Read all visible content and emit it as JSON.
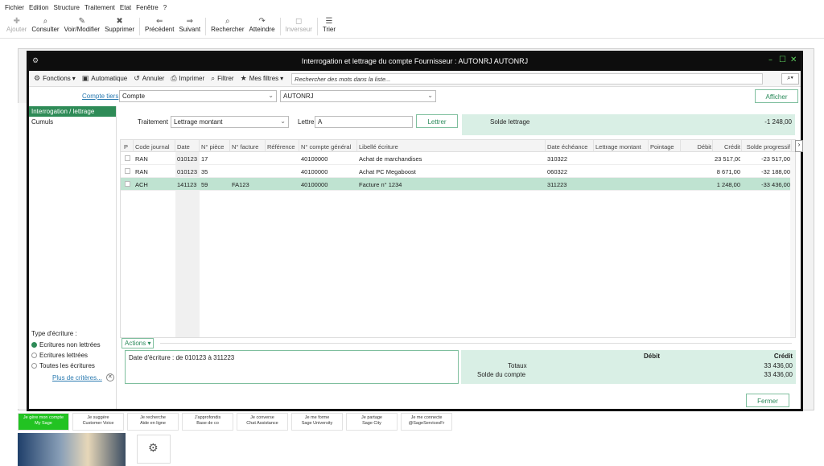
{
  "menu": [
    "Fichier",
    "Edition",
    "Structure",
    "Traitement",
    "Etat",
    "Fenêtre",
    "?"
  ],
  "toolbar": [
    {
      "label": "Ajouter",
      "icon": "plus-icon",
      "glyph": "✚",
      "disabled": true
    },
    {
      "label": "Consulter",
      "icon": "search-icon",
      "glyph": "⌕",
      "disabled": false
    },
    {
      "label": "Voir/Modifier",
      "icon": "edit-icon",
      "glyph": "✎",
      "disabled": false
    },
    {
      "label": "Supprimer",
      "icon": "delete-icon",
      "glyph": "✖",
      "disabled": false
    },
    {
      "label": "Précédent",
      "icon": "prev-icon",
      "glyph": "⇐",
      "disabled": false
    },
    {
      "label": "Suivant",
      "icon": "next-icon",
      "glyph": "⇒",
      "disabled": false
    },
    {
      "label": "Rechercher",
      "icon": "find-icon",
      "glyph": "⌕",
      "disabled": false
    },
    {
      "label": "Atteindre",
      "icon": "goto-icon",
      "glyph": "↷",
      "disabled": false
    },
    {
      "label": "Inverseur",
      "icon": "invert-icon",
      "glyph": "◻",
      "disabled": true
    },
    {
      "label": "Trier",
      "icon": "sort-icon",
      "glyph": "☰",
      "disabled": false
    }
  ],
  "dialog": {
    "title": "Interrogation et lettrage du compte Fournisseur : AUTONRJ AUTONRJ",
    "toolbar": {
      "fonctions": "Fonctions",
      "automatique": "Automatique",
      "annuler": "Annuler",
      "imprimer": "Imprimer",
      "filtrer": "Filtrer",
      "mes_filtres": "Mes filtres",
      "search_placeholder": "Rechercher des mots dans la liste..."
    },
    "compte_tiers_label": "Compte tiers",
    "compte_type": "Compte",
    "compte_value": "AUTONRJ",
    "afficher": "Afficher",
    "nav": [
      "Interrogation / lettrage",
      "Cumuls"
    ],
    "ecriture_title": "Type d'écriture :",
    "ecriture_options": [
      "Ecritures non lettrées",
      "Ecritures lettrées",
      "Toutes les écritures"
    ],
    "plus_criteres": "Plus de critères...",
    "traitement_label": "Traitement",
    "traitement_value": "Lettrage montant",
    "lettre_label": "Lettre",
    "lettre_value": "A",
    "lettrer": "Lettrer",
    "solde_label": "Solde lettrage",
    "solde_value": "-1 248,00",
    "columns": [
      "P",
      "Code journal",
      "Date",
      "N° pièce",
      "N° facture",
      "Référence",
      "N° compte général",
      "Libellé écriture",
      "Date échéance",
      "Lettrage montant",
      "Pointage",
      "Débit",
      "Crédit",
      "Solde progressif"
    ],
    "rows": [
      {
        "p": "",
        "journal": "RAN",
        "date": "010123",
        "piece": "17",
        "facture": "",
        "reference": "",
        "compte": "40100000",
        "libelle": "Achat de marchandises",
        "echeance": "310322",
        "lettrage": "",
        "pointage": "",
        "debit": "",
        "credit": "23 517,00",
        "solde": "-23 517,00"
      },
      {
        "p": "",
        "journal": "RAN",
        "date": "010123",
        "piece": "35",
        "facture": "",
        "reference": "",
        "compte": "40100000",
        "libelle": "Achat PC Megaboost",
        "echeance": "060322",
        "lettrage": "",
        "pointage": "",
        "debit": "",
        "credit": "8 671,00",
        "solde": "-32 188,00"
      },
      {
        "p": "",
        "journal": "ACH",
        "date": "141123",
        "piece": "59",
        "facture": "FA123",
        "reference": "",
        "compte": "40100000",
        "libelle": "Facture n° 1234",
        "echeance": "311223",
        "lettrage": "",
        "pointage": "",
        "debit": "",
        "credit": "1 248,00",
        "solde": "-33 436,00"
      }
    ],
    "actions": "Actions",
    "critere_text": "Date d'écriture : de 010123 à 311223",
    "totals": {
      "debit_label": "Débit",
      "credit_label": "Crédit",
      "totaux_label": "Totaux",
      "totaux_credit": "33 436,00",
      "solde_label": "Solde du compte",
      "solde_credit": "33 436,00"
    },
    "fermer": "Fermer"
  },
  "tiles": [
    {
      "line1": "Je gère mon compte",
      "line2": "My Sage",
      "green": true
    },
    {
      "line1": "Je suggère",
      "line2": "Customer Voice",
      "green": false
    },
    {
      "line1": "Je recherche",
      "line2": "Aide en ligne",
      "green": false
    },
    {
      "line1": "J'approfondis",
      "line2": "Base de co",
      "green": false
    },
    {
      "line1": "Je converse",
      "line2": "Chat Assistance",
      "green": false
    },
    {
      "line1": "Je me forme",
      "line2": "Sage University",
      "green": false
    },
    {
      "line1": "Je partage",
      "line2": "Sage City",
      "green": false
    },
    {
      "line1": "Je me connecte",
      "line2": "@SageServicesFr",
      "green": false
    }
  ],
  "colors": {
    "accent": "#2e8b57",
    "selected_row": "#bfe3d1",
    "panel": "#d9efe5"
  }
}
